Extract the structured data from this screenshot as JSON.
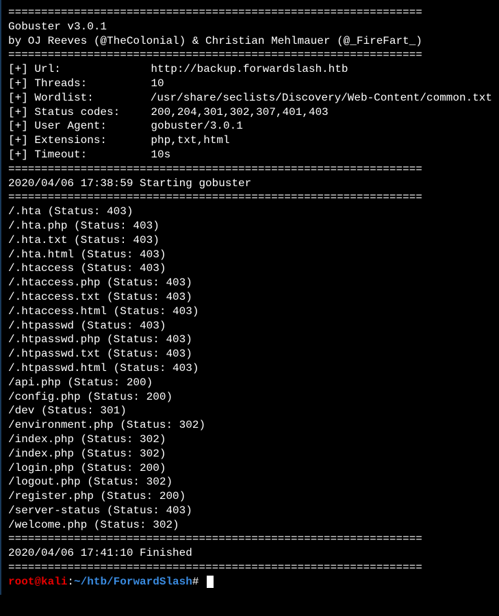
{
  "separator": "===============================================================",
  "header": {
    "title": "Gobuster v3.0.1",
    "byline": "by OJ Reeves (@TheColonial) & Christian Mehlmauer (@_FireFart_)"
  },
  "config": [
    {
      "prefix": "[+] ",
      "label": "Url:",
      "value": "http://backup.forwardslash.htb"
    },
    {
      "prefix": "[+] ",
      "label": "Threads:",
      "value": "10"
    },
    {
      "prefix": "[+] ",
      "label": "Wordlist:",
      "value": "/usr/share/seclists/Discovery/Web-Content/common.txt"
    },
    {
      "prefix": "[+] ",
      "label": "Status codes:",
      "value": "200,204,301,302,307,401,403"
    },
    {
      "prefix": "[+] ",
      "label": "User Agent:",
      "value": "gobuster/3.0.1"
    },
    {
      "prefix": "[+] ",
      "label": "Extensions:",
      "value": "php,txt,html"
    },
    {
      "prefix": "[+] ",
      "label": "Timeout:",
      "value": "10s"
    }
  ],
  "start_line": "2020/04/06 17:38:59 Starting gobuster",
  "results": [
    "/.hta (Status: 403)",
    "/.hta.php (Status: 403)",
    "/.hta.txt (Status: 403)",
    "/.hta.html (Status: 403)",
    "/.htaccess (Status: 403)",
    "/.htaccess.php (Status: 403)",
    "/.htaccess.txt (Status: 403)",
    "/.htaccess.html (Status: 403)",
    "/.htpasswd (Status: 403)",
    "/.htpasswd.php (Status: 403)",
    "/.htpasswd.txt (Status: 403)",
    "/.htpasswd.html (Status: 403)",
    "/api.php (Status: 200)",
    "/config.php (Status: 200)",
    "/dev (Status: 301)",
    "/environment.php (Status: 302)",
    "/index.php (Status: 302)",
    "/index.php (Status: 302)",
    "/login.php (Status: 200)",
    "/logout.php (Status: 302)",
    "/register.php (Status: 200)",
    "/server-status (Status: 403)",
    "/welcome.php (Status: 302)"
  ],
  "end_line": "2020/04/06 17:41:10 Finished",
  "prompt": {
    "user": "root",
    "at": "@",
    "host": "kali",
    "colon": ":",
    "path": "~/htb/ForwardSlash",
    "hash": "# "
  }
}
